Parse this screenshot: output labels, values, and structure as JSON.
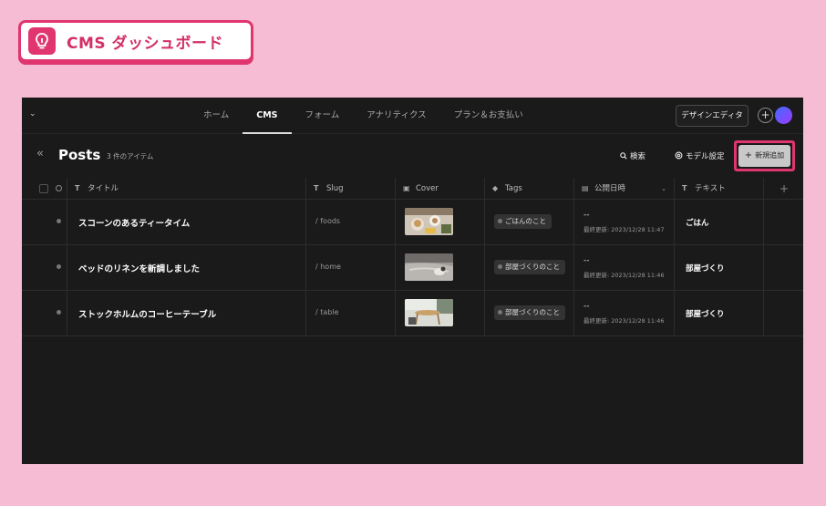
{
  "banner": {
    "title": "CMS ダッシュボード",
    "icon": "lightbulb-icon",
    "accent": "#e0356f"
  },
  "topbar": {
    "tabs": [
      {
        "label": "ホーム",
        "active": false
      },
      {
        "label": "CMS",
        "active": true
      },
      {
        "label": "フォーム",
        "active": false
      },
      {
        "label": "アナリティクス",
        "active": false
      },
      {
        "label": "プラン＆お支払い",
        "active": false
      }
    ],
    "design_editor_label": "デザインエディタ",
    "plus_label": "+"
  },
  "posts": {
    "title": "Posts",
    "count": "3 件のアイテム",
    "search_label": "検索",
    "model_settings_label": "モデル設定",
    "new_label": "新規追加"
  },
  "table": {
    "headers": {
      "title": "タイトル",
      "slug": "Slug",
      "cover": "Cover",
      "tags": "Tags",
      "published": "公開日時",
      "text": "テキスト",
      "add": "+"
    },
    "rows": [
      {
        "title": "スコーンのあるティータイム",
        "slug": "/ foods",
        "tag": "ごはんのこと",
        "date": "--",
        "updated": "最終更新: 2023/12/28 11:47",
        "text": "ごはん"
      },
      {
        "title": "ベッドのリネンを新調しました",
        "slug": "/ home",
        "tag": "部屋づくりのこと",
        "date": "--",
        "updated": "最終更新: 2023/12/28 11:46",
        "text": "部屋づくり"
      },
      {
        "title": "ストックホルムのコーヒーテーブル",
        "slug": "/ table",
        "tag": "部屋づくりのこと",
        "date": "--",
        "updated": "最終更新: 2023/12/28 11:46",
        "text": "部屋づくり"
      }
    ]
  }
}
